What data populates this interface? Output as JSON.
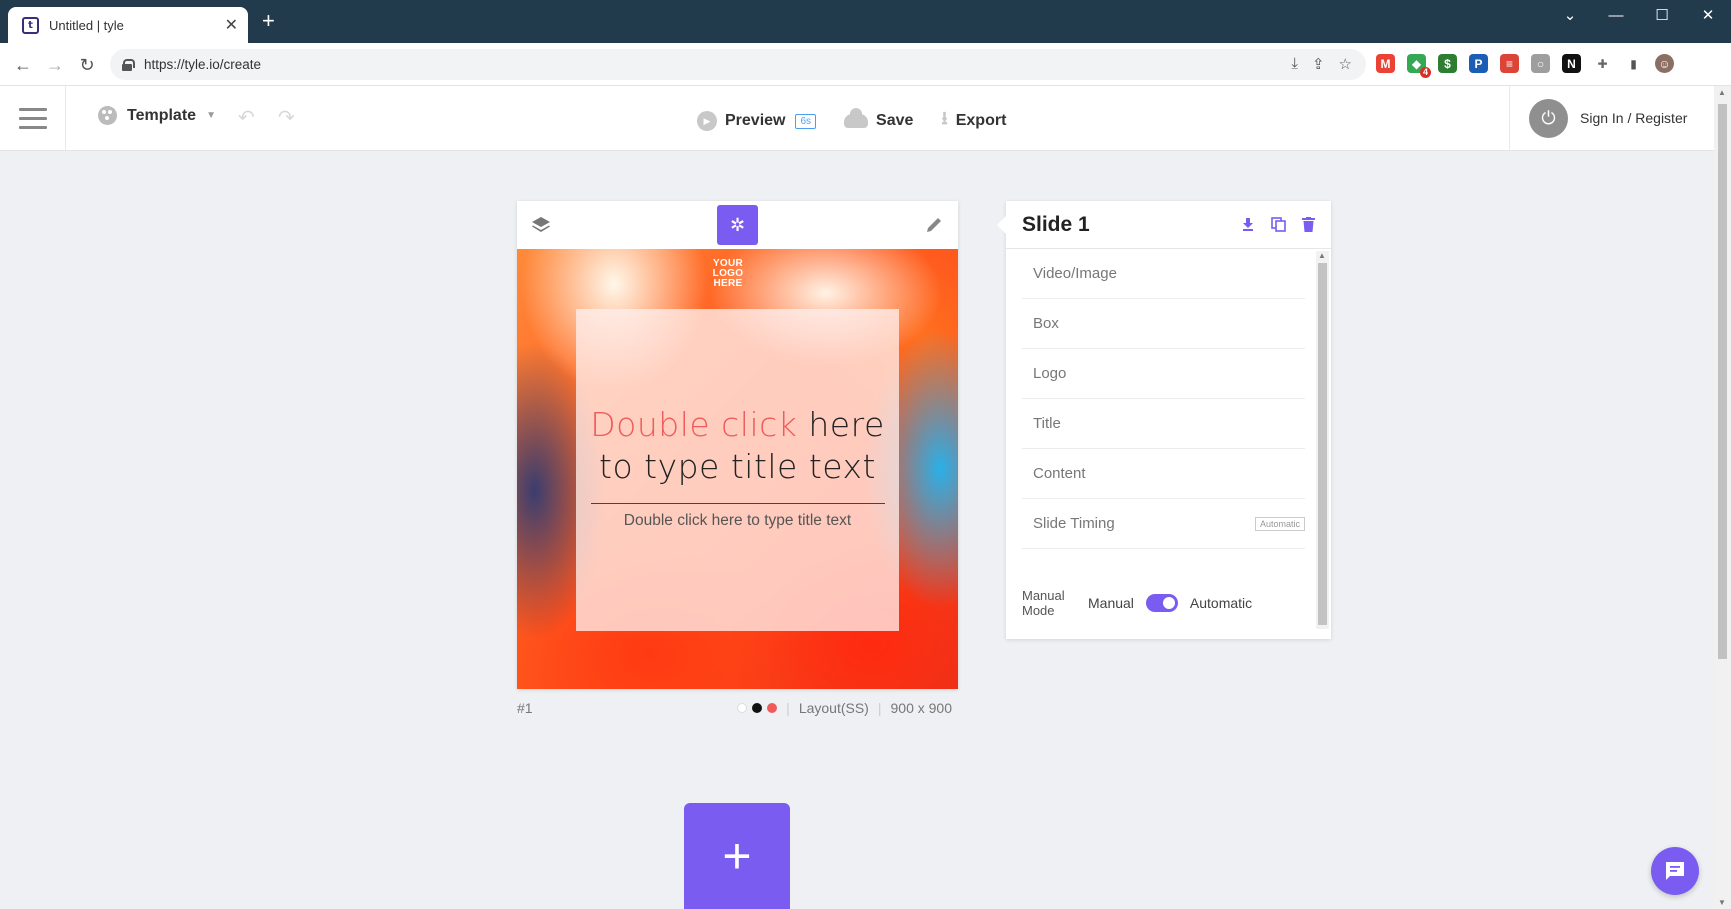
{
  "browser": {
    "tab_title": "Untitled | tyle",
    "tab_favicon_label": "t",
    "tab_close": "✕",
    "new_tab": "+",
    "url": "https://tyle.io/create",
    "window_controls": [
      "⌄",
      "—",
      "☐",
      "✕"
    ],
    "extensions": [
      {
        "icon": "gmail-icon",
        "label": "M",
        "color": "#ea4335"
      },
      {
        "icon": "green-ext-icon",
        "label": "◆",
        "color": "#34a853",
        "badge": "4"
      },
      {
        "icon": "money-ext-icon",
        "label": "$",
        "color": "#2e7d32"
      },
      {
        "icon": "blue-ext-icon",
        "label": "P",
        "color": "#1a5fb4"
      },
      {
        "icon": "red-ext-icon",
        "label": "≡",
        "color": "#db4437"
      },
      {
        "icon": "grey-ext-icon",
        "label": "○",
        "color": "#9e9e9e"
      },
      {
        "icon": "notion-icon",
        "label": "N",
        "color": "#111111"
      },
      {
        "icon": "puzzle-icon",
        "label": "✚",
        "color": "#666666"
      },
      {
        "icon": "sidepanel-icon",
        "label": "▮",
        "color": "#555555"
      },
      {
        "icon": "profile-avatar",
        "label": "☺",
        "color": "#8d6e63"
      }
    ]
  },
  "header": {
    "template_label": "Template",
    "preview_label": "Preview",
    "preview_badge": "6s",
    "save_label": "Save",
    "export_label": "Export",
    "signin_label": "Sign In / Register"
  },
  "slide": {
    "logo_text": "YOUR LOGO HERE",
    "title_highlight": "Double click",
    "title_rest": " here to type title text",
    "subtitle": "Double click here to type title text",
    "number": "#1",
    "layout": "Layout(SS)",
    "size": "900 x 900",
    "colors": [
      "#ffffff",
      "#111111",
      "#f05a5a"
    ]
  },
  "panel": {
    "title": "Slide 1",
    "items": [
      "Video/Image",
      "Box",
      "Logo",
      "Title",
      "Content",
      "Slide Timing"
    ],
    "timing_badge": "Automatic",
    "mode_label": "Manual Mode",
    "manual_label": "Manual",
    "automatic_label": "Automatic",
    "mode_value": "Automatic"
  },
  "accent_color": "#7a5cf0",
  "add_slide": "+"
}
